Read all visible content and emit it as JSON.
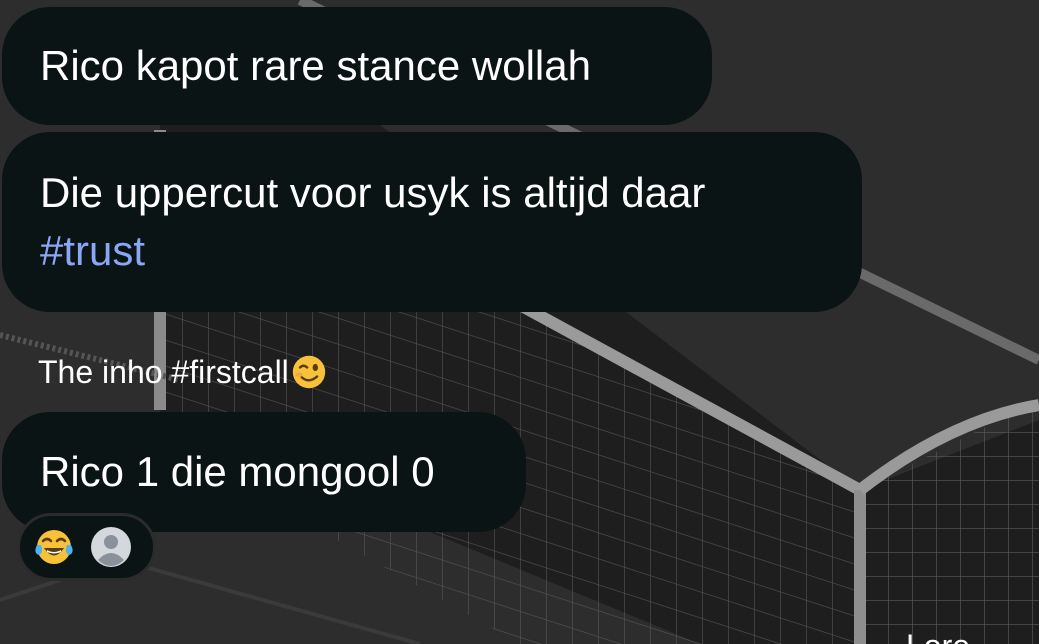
{
  "chat": {
    "messages": [
      {
        "text": "Rico kapot rare stance wollah"
      },
      {
        "text": "Die uppercut voor usyk is altijd daar",
        "hashtag": "#trust"
      },
      {
        "text": "Rico 1 die mongool 0"
      }
    ],
    "caption": {
      "text": "The inho #firstcall",
      "emoji": "winking-face"
    },
    "reactions": {
      "emoji": "face-with-tears-of-joy",
      "avatar": "default-user-avatar"
    },
    "corner_text": "Lore"
  },
  "colors": {
    "bubble": "#0a1414",
    "hashtag": "#8aa6f5",
    "background": "#2b2b2b"
  },
  "wallpaper": {
    "subject": "football-goal-net"
  }
}
